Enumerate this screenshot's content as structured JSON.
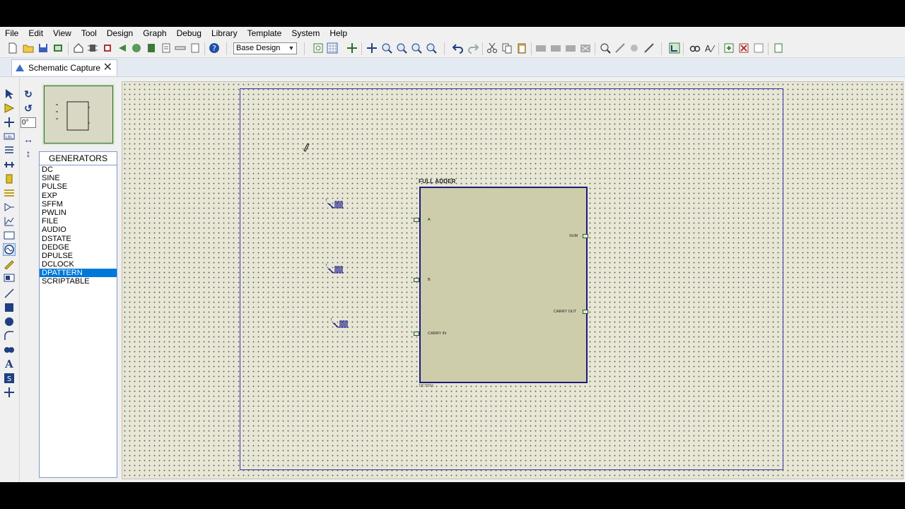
{
  "menu": [
    "File",
    "Edit",
    "View",
    "Tool",
    "Design",
    "Graph",
    "Debug",
    "Library",
    "Template",
    "System",
    "Help"
  ],
  "toolbar": {
    "design_combo_value": "Base Design",
    "combo_arrow": "chevron-down-icon"
  },
  "tab": {
    "label": "Schematic Capture",
    "close_glyph": "✕"
  },
  "rotation": {
    "angle_value": "0°"
  },
  "devices": {
    "header": "GENERATORS",
    "items": [
      "DC",
      "SINE",
      "PULSE",
      "EXP",
      "SFFM",
      "PWLIN",
      "FILE",
      "AUDIO",
      "DSTATE",
      "DEDGE",
      "DPULSE",
      "DCLOCK",
      "DPATTERN",
      "SCRIPTABLE"
    ],
    "selected": "DPATTERN"
  },
  "schematic": {
    "block_title": "FULL ADDER",
    "ref_designator": "DCT001",
    "pins": {
      "a": "A",
      "b": "B",
      "carry_in": "CARRY IN",
      "sum": "SUM",
      "carry_out": "CARRY OUT"
    },
    "generator_ref": "?"
  },
  "colors": {
    "selection": "#0078d7",
    "sheet_border": "#3535a8",
    "block_fill": "#cdcdab",
    "block_border": "#1a1a7a",
    "canvas": "#e8e6d4"
  }
}
